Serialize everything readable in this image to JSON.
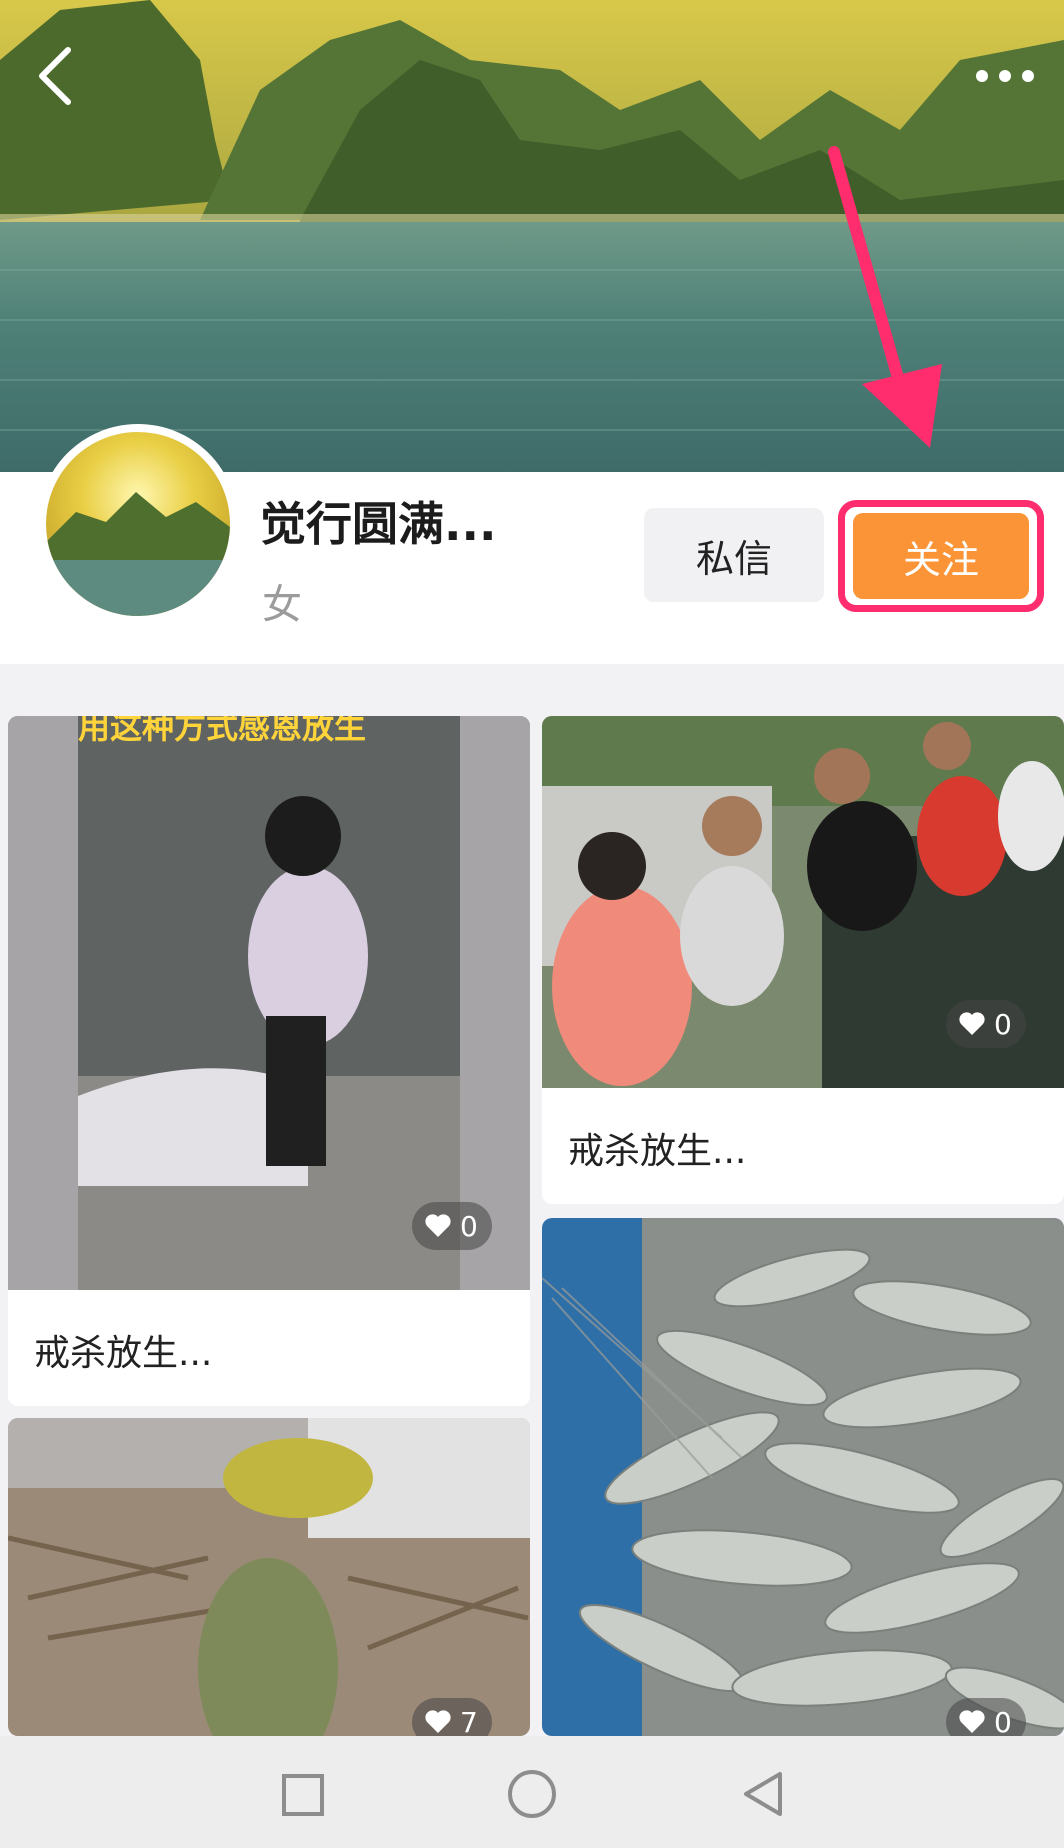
{
  "header": {
    "back_icon": "chevron-left-icon",
    "more_icon": "more-dots-icon"
  },
  "profile": {
    "username": "觉行圆满...",
    "gender": "女",
    "message_button": "私信",
    "follow_button": "关注"
  },
  "colors": {
    "follow_bg": "#fa9436",
    "highlight": "#ff2d6d"
  },
  "feed": [
    {
      "title": "戒杀放生...",
      "likes": "0",
      "caption_overlay": "用这种方式感恩放生"
    },
    {
      "title": "戒杀放生...",
      "likes": "0"
    },
    {
      "likes": "7"
    },
    {
      "likes": "0"
    }
  ],
  "navbar": {
    "recent_icon": "square-icon",
    "home_icon": "circle-icon",
    "back_icon": "triangle-back-icon"
  }
}
